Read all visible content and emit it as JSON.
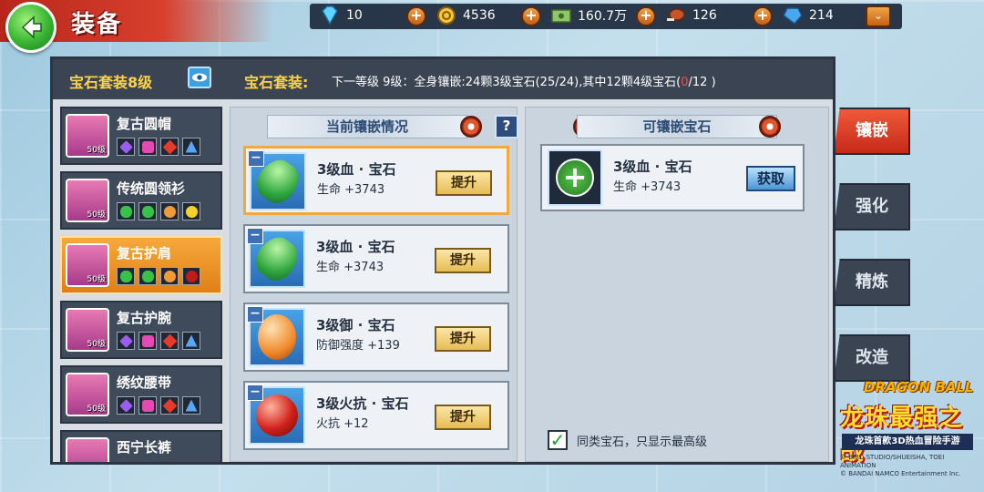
{
  "header": {
    "title": "装备",
    "resources": [
      {
        "name": "diamond",
        "icon": "diamond-icon",
        "value": "10"
      },
      {
        "name": "coin",
        "icon": "coin-icon",
        "value": "4536"
      },
      {
        "name": "cash",
        "icon": "cash-icon",
        "value": "160.7万"
      },
      {
        "name": "meat",
        "icon": "meat-icon",
        "value": "126"
      },
      {
        "name": "crystal",
        "icon": "crystal-icon",
        "value": "214"
      }
    ]
  },
  "panel": {
    "set_level": "宝石套装8级",
    "set_label": "宝石套装:",
    "set_desc_prefix": "下一等级 9级：全身镶嵌:24颗3级宝石(25/24),其中12颗4级宝石(",
    "set_desc_highlight": "0",
    "set_desc_suffix": "/12 )"
  },
  "equipment": [
    {
      "name": "复古圆帽",
      "level": "50级",
      "gems": [
        "purple",
        "pink",
        "red",
        "blue"
      ],
      "active": false
    },
    {
      "name": "传统圆领衫",
      "level": "50级",
      "gems": [
        "green",
        "green",
        "orange",
        "yellow"
      ],
      "active": false
    },
    {
      "name": "复古护肩",
      "level": "50级",
      "gems": [
        "green",
        "green",
        "orange",
        "ruby"
      ],
      "active": true
    },
    {
      "name": "复古护腕",
      "level": "50级",
      "gems": [
        "purple",
        "pink",
        "red",
        "blue"
      ],
      "active": false
    },
    {
      "name": "绣纹腰带",
      "level": "50级",
      "gems": [
        "purple",
        "pink",
        "red",
        "blue"
      ],
      "active": false
    },
    {
      "name": "西宁长裤",
      "level": "",
      "gems": [],
      "active": false
    }
  ],
  "current": {
    "title": "当前镶嵌情况",
    "help": "?",
    "slots": [
      {
        "name": "3级血 · 宝石",
        "stat": "生命 +3743",
        "gem": "green",
        "button": "提升",
        "selected": true
      },
      {
        "name": "3级血 · 宝石",
        "stat": "生命 +3743",
        "gem": "green",
        "button": "提升",
        "selected": false
      },
      {
        "name": "3级御 · 宝石",
        "stat": "防御强度 +139",
        "gem": "orange",
        "button": "提升",
        "selected": false
      },
      {
        "name": "3级火抗 · 宝石",
        "stat": "火抗 +12",
        "gem": "ruby",
        "button": "提升",
        "selected": false
      }
    ]
  },
  "available": {
    "title": "可镶嵌宝石",
    "items": [
      {
        "name": "3级血 · 宝石",
        "stat": "生命 +3743",
        "button": "获取"
      }
    ],
    "filter_label": "同类宝石，只显示最高级",
    "filter_checked": true
  },
  "tabs": [
    {
      "label": "镶嵌",
      "active": true
    },
    {
      "label": "强化",
      "active": false
    },
    {
      "label": "精炼",
      "active": false
    },
    {
      "label": "改造",
      "active": false
    }
  ],
  "logo": {
    "brand": "DRAGON BALL",
    "name": "龙珠最强之战",
    "tagline": "龙珠首款3D热血冒险手游",
    "copyright_1": "© BIRD STUDIO/SHUEISHA, TOEI ANIMATION",
    "copyright_2": "© BANDAI NAMCO Entertainment Inc."
  },
  "colors": {
    "accent_orange": "#f3a83b",
    "panel_dark": "#3a4452",
    "highlight_red": "#ff4a3a",
    "title_gold": "#ffd24a"
  }
}
